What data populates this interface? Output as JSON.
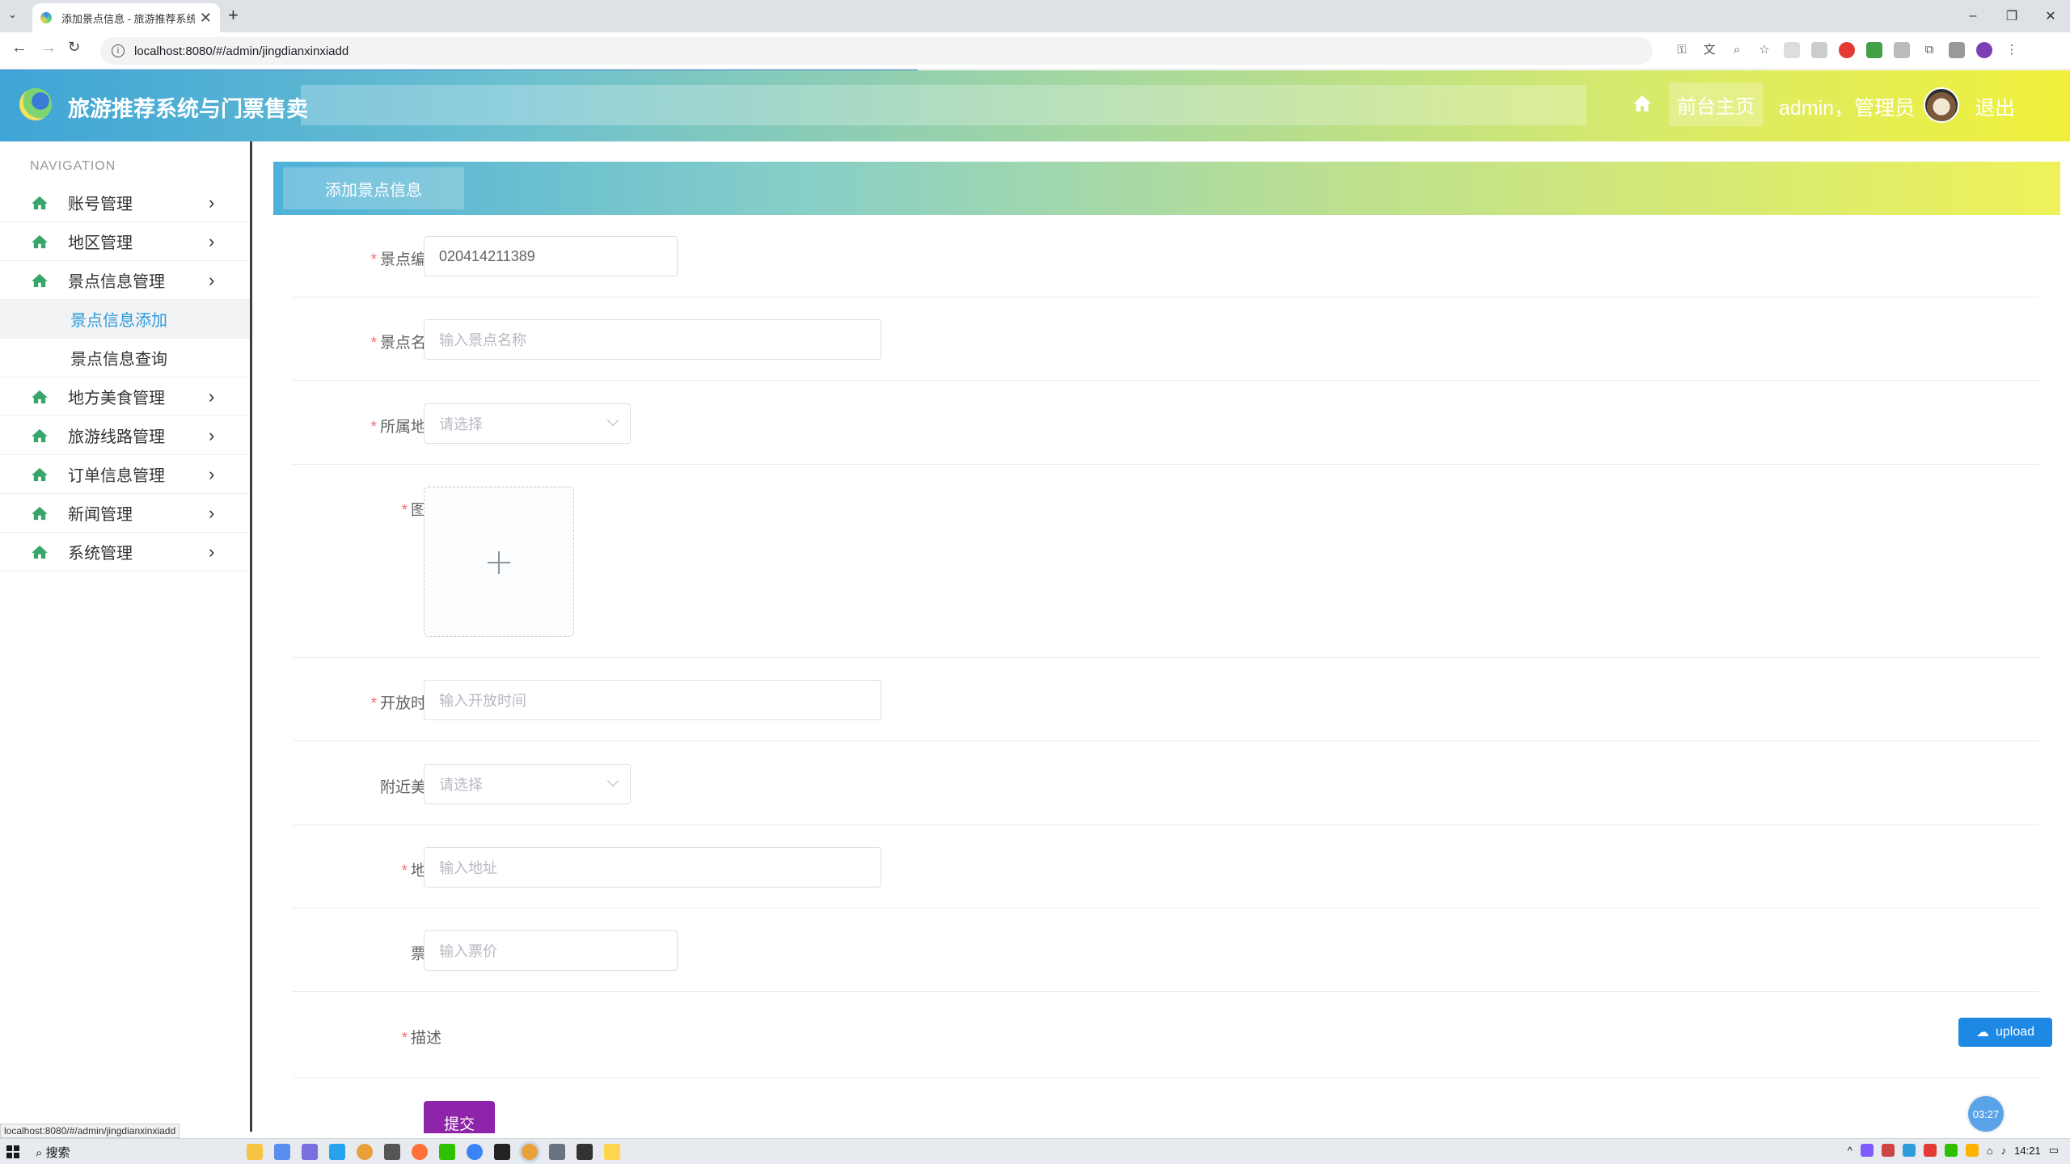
{
  "browser": {
    "tab_title": "添加景点信息 - 旅游推荐系统与",
    "url": "localhost:8080/#/admin/jingdianxinxiadd",
    "status_url": "localhost:8080/#/admin/jingdianxinxiadd",
    "new_tab": "+",
    "close_tab": "✕"
  },
  "header": {
    "brand": "旅游推荐系统与门票售卖",
    "home_btn": "前台主页",
    "user": "admin，管理员",
    "logout": "退出"
  },
  "sidebar": {
    "nav_title": "NAVIGATION",
    "items": [
      {
        "label": "账号管理"
      },
      {
        "label": "地区管理"
      },
      {
        "label": "景点信息管理"
      },
      {
        "label": "地方美食管理"
      },
      {
        "label": "旅游线路管理"
      },
      {
        "label": "订单信息管理"
      },
      {
        "label": "新闻管理"
      },
      {
        "label": "系统管理"
      }
    ],
    "sub_items": [
      {
        "label": "景点信息添加",
        "active": true
      },
      {
        "label": "景点信息查询",
        "active": false
      }
    ]
  },
  "main": {
    "tab_title": "添加景点信息",
    "fields": {
      "code": {
        "label": "景点编号",
        "value": "020414211389"
      },
      "name": {
        "label": "景点名称",
        "placeholder": "输入景点名称"
      },
      "region": {
        "label": "所属地区",
        "placeholder": "请选择"
      },
      "image": {
        "label": "图片"
      },
      "open_time": {
        "label": "开放时间",
        "placeholder": "输入开放时间"
      },
      "food": {
        "label": "附近美食",
        "placeholder": "请选择"
      },
      "address": {
        "label": "地址",
        "placeholder": "输入地址"
      },
      "price": {
        "label": "票价",
        "placeholder": "输入票价"
      },
      "desc": {
        "label": "描述"
      }
    },
    "upload_btn": "upload",
    "submit_btn": "提交"
  },
  "timer": "03:27",
  "taskbar": {
    "search": "搜索",
    "time": "14:21"
  },
  "colors": {
    "accent": "#2f9bdc",
    "required": "#f56c6c",
    "submit": "#8e24aa",
    "upload": "#1e88e5"
  }
}
